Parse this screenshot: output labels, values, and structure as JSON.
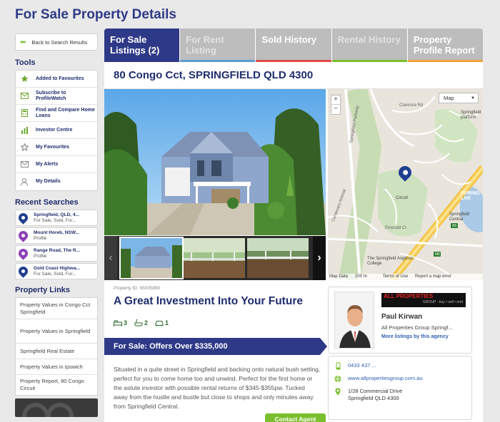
{
  "page": {
    "title": "For Sale Property Details"
  },
  "sidebar": {
    "back_label": "Back to Search Results",
    "tools_heading": "Tools",
    "tools": [
      {
        "label": "Added to Favourites",
        "icon": "star-icon"
      },
      {
        "label": "Subscribe to ProfileWatch",
        "icon": "envelope-icon"
      },
      {
        "label": "Find and Compare Home Loans",
        "icon": "calculator-icon"
      },
      {
        "label": "Investor Centre",
        "icon": "chart-icon"
      },
      {
        "label": "My Favourites",
        "icon": "star-outline-icon"
      },
      {
        "label": "My Alerts",
        "icon": "envelope-icon"
      },
      {
        "label": "My Details",
        "icon": "person-icon"
      }
    ],
    "recent_heading": "Recent Searches",
    "recent": [
      {
        "title": "Springfield, QLD, 4...",
        "sub": "For Sale, Sold, For...",
        "color": "#1f3f8f"
      },
      {
        "title": "Mount Horeb, NSW...",
        "sub": "Profile",
        "color": "#8e3fb8"
      },
      {
        "title": "Range Road, The R...",
        "sub": "Profile",
        "color": "#8e3fb8"
      },
      {
        "title": "Gold Coast Highwa...",
        "sub": "For Sale, Sold, For...",
        "color": "#1f3f8f"
      }
    ],
    "links_heading": "Property Links",
    "links": [
      "Property Values in Congo Cct Springfield",
      "Property Values in Springfield",
      "Springfield Real Estate",
      "Property Values in Ipswich",
      "Property Report, 80 Congo Circuit"
    ]
  },
  "tabs": [
    {
      "label": "For Sale Listings (2)",
      "state": "active"
    },
    {
      "label": "For Rent Listing",
      "state": "dim"
    },
    {
      "label": "Sold History",
      "state": "normal"
    },
    {
      "label": "Rental History",
      "state": "dim"
    },
    {
      "label": "Property Profile Report",
      "state": "normal"
    }
  ],
  "listing": {
    "address": "80 Congo Cct, SPRINGFIELD QLD 4300",
    "property_id": "Property ID: 55005880",
    "headline": "A Great Investment Into Your Future",
    "bedrooms": "3",
    "bathrooms": "2",
    "car_spaces": "1",
    "price": "For Sale: Offers Over $335,000",
    "description": "Situated in a quite street in Springfield and backing onto natural bush setting, perfect for you to come home too and unwind. Perfect for the first home or the astute investor with possible rental returns of $345-$355pw. Tucked away from the hustle and bustle but close to shops and only minutes away from Springfield Central."
  },
  "map": {
    "type_label": "Map",
    "zoom_in": "+",
    "zoom_out": "−",
    "labels": {
      "springfield_pkwy": "Springfield Parkway",
      "clarence": "Clarence Rd",
      "springfield_platform": "Springfield platform",
      "springfield_lakes": "SPRING LAK",
      "central": "Springfield Central",
      "anglican": "The Springfield Anglican College",
      "emerald": "Emerald Cr",
      "a5": "A5",
      "m5": "M5",
      "arterial": "Centenary Arterial",
      "circuit": "Circuit"
    },
    "footer": {
      "data": "Map Data",
      "scale": "200 m",
      "terms": "Terms of Use",
      "report": "Report a map error"
    }
  },
  "agent": {
    "logo_main": "ALL PROPERTIES",
    "logo_sub": "GROUP",
    "logo_tag": "buy • sell • rent",
    "name": "Paul Kirwan",
    "company": "All Properties Group Springf...",
    "more": "More listings by this agency",
    "phone": "0433 437 ...",
    "website": "www.allpropertiesgroup.com.au",
    "address_line1": "1/28 Commercial Drive",
    "address_line2": "Springfield QLD 4300",
    "contact_button": "Contact Agent"
  }
}
